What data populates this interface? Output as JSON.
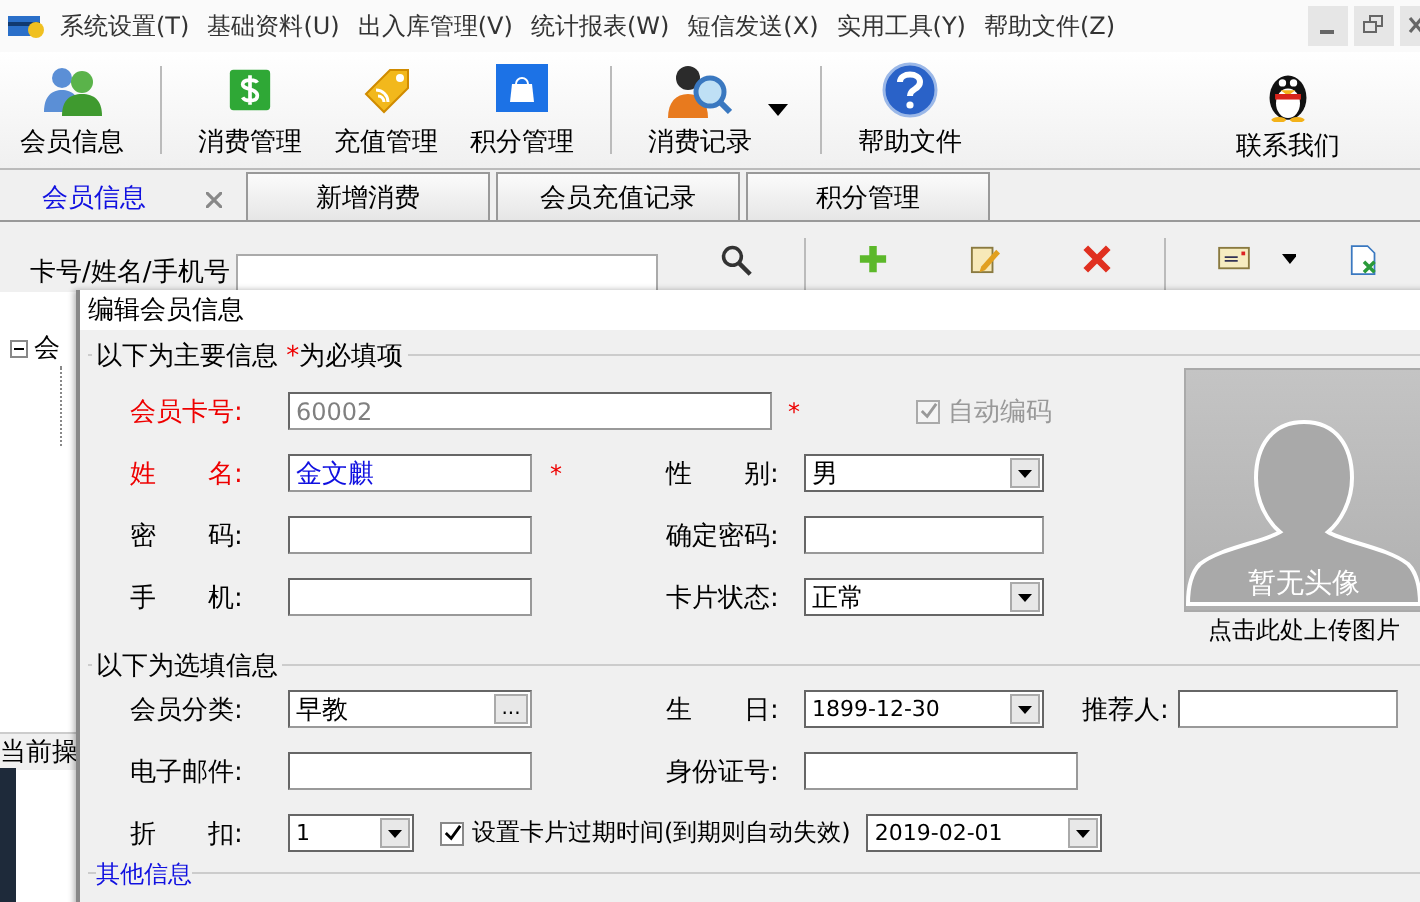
{
  "menu": [
    {
      "label": "系统设置(T)"
    },
    {
      "label": "基础资料(U)"
    },
    {
      "label": "出入库管理(V)"
    },
    {
      "label": "统计报表(W)"
    },
    {
      "label": "短信发送(X)"
    },
    {
      "label": "实用工具(Y)"
    },
    {
      "label": "帮助文件(Z)"
    }
  ],
  "toolbar_groups": [
    [
      {
        "label": "会员信息",
        "kind": "people"
      }
    ],
    [
      {
        "label": "消费管理",
        "kind": "dollar"
      },
      {
        "label": "充值管理",
        "kind": "tag"
      },
      {
        "label": "积分管理",
        "kind": "bag"
      }
    ],
    [
      {
        "label": "消费记录",
        "kind": "magnifier-person",
        "dropdown": true
      }
    ],
    [
      {
        "label": "帮助文件",
        "kind": "help"
      }
    ]
  ],
  "toolbar_right": {
    "label": "联系我们",
    "kind": "penguin"
  },
  "tabs": [
    {
      "label": "会员信息",
      "selected": true,
      "closable": true
    },
    {
      "label": "新增消费",
      "selected": false,
      "closable": false
    },
    {
      "label": "会员充值记录",
      "selected": false,
      "closable": false
    },
    {
      "label": "积分管理",
      "selected": false,
      "closable": false
    }
  ],
  "search": {
    "label": "卡号/姓名/手机号",
    "action_groups": [
      [
        {
          "kind": "search"
        }
      ],
      [
        {
          "kind": "add"
        },
        {
          "kind": "edit"
        },
        {
          "kind": "delete"
        }
      ],
      [
        {
          "kind": "card",
          "dropdown": true
        },
        {
          "kind": "export"
        }
      ]
    ]
  },
  "tree": {
    "label": "会",
    "expanded": true
  },
  "status_label": "当前操",
  "dialog": {
    "title": "编辑会员信息",
    "main_legend": "以下为主要信息 ",
    "required_mark": "*",
    "main_legend_tail": "为必填项",
    "card_no": {
      "label": "会员卡号:",
      "required": true,
      "value": "60002",
      "disabled": true
    },
    "auto_code": {
      "label": "自动编码",
      "checked": true,
      "disabled": true
    },
    "name": {
      "label": "姓　　名:",
      "required": true,
      "value": "金文麒"
    },
    "gender": {
      "label": "性　　别:",
      "value": "男"
    },
    "password": {
      "label": "密　　码:"
    },
    "confirm_password": {
      "label": "确定密码:"
    },
    "mobile": {
      "label": "手　　机:"
    },
    "card_status": {
      "label": "卡片状态:",
      "value": "正常"
    },
    "photo": {
      "placeholder": "暂无头像",
      "caption": "点击此处上传图片"
    },
    "optional_legend": "以下为选填信息",
    "category": {
      "label": "会员分类:",
      "value": "早教",
      "button": "..."
    },
    "birthday": {
      "label": "生　　日:",
      "value": "1899-12-30"
    },
    "referrer": {
      "label": "推荐人:"
    },
    "email": {
      "label": "电子邮件:"
    },
    "id_no": {
      "label": "身份证号:"
    },
    "discount": {
      "label": "折　　扣:",
      "value": "1"
    },
    "expiry": {
      "label": "设置卡片过期时间(到期则自动失效)",
      "checked": true,
      "value": "2019-02-01"
    },
    "other_legend": "其他信息"
  }
}
